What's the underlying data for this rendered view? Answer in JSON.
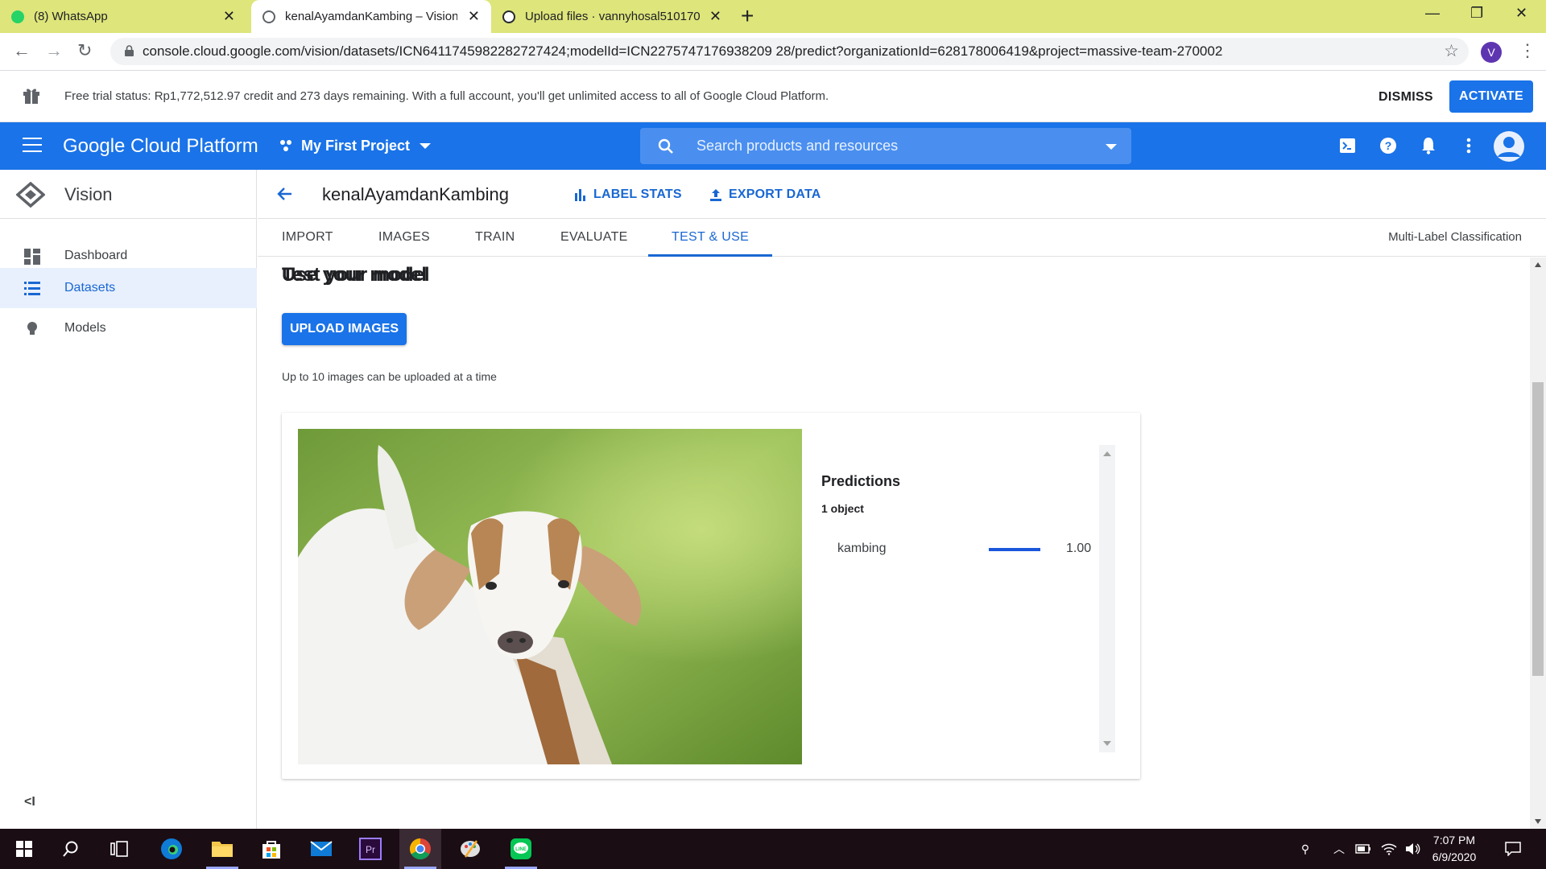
{
  "browser": {
    "tabs": [
      {
        "label": "(8) WhatsApp",
        "active": false
      },
      {
        "label": "kenalAyamdanKambing – Vision",
        "active": true
      },
      {
        "label": "Upload files · vannyhosal510170",
        "active": false
      }
    ],
    "url": "console.cloud.google.com/vision/datasets/ICN6411745982282727424;modelId=ICN2275747176938209 28/predict?organizationId=628178006419&project=massive-team-270002",
    "profile_initial": "V"
  },
  "trial": {
    "message": "Free trial status: Rp1,772,512.97 credit and 273 days remaining. With a full account, you'll get unlimited access to all of Google Cloud Platform.",
    "dismiss_label": "DISMISS",
    "activate_label": "ACTIVATE"
  },
  "header": {
    "brand": "Google Cloud Platform",
    "project": "My First Project",
    "search_placeholder": "Search products and resources"
  },
  "sidebar": {
    "product": "Vision",
    "items": [
      {
        "label": "Dashboard",
        "icon": "dashboard-icon",
        "selected": false
      },
      {
        "label": "Datasets",
        "icon": "list-icon",
        "selected": true
      },
      {
        "label": "Models",
        "icon": "lightbulb-icon",
        "selected": false
      }
    ],
    "collapse_label": "<I"
  },
  "dataset": {
    "name": "kenalAyamdanKambing",
    "label_stats": "LABEL STATS",
    "export_data": "EXPORT DATA"
  },
  "tabs": {
    "items": [
      "IMPORT",
      "IMAGES",
      "TRAIN",
      "EVALUATE",
      "TEST & USE"
    ],
    "active": "TEST & USE",
    "classification": "Multi-Label Classification"
  },
  "test": {
    "title": "Test your model",
    "upload_label": "UPLOAD IMAGES",
    "hint": "Up to 10 images can be uploaded at a time",
    "predictions_title": "Predictions",
    "predictions_count": "1 object",
    "predictions": [
      {
        "label": "kambing",
        "score_text": "1.00",
        "score": 1.0
      }
    ],
    "use_title": "Use your model"
  },
  "taskbar": {
    "time": "7:07 PM",
    "date": "6/9/2020"
  },
  "colors": {
    "gcp_blue": "#1a73e8",
    "tabbar": "#dde57b",
    "taskbar": "#1b0d14"
  }
}
